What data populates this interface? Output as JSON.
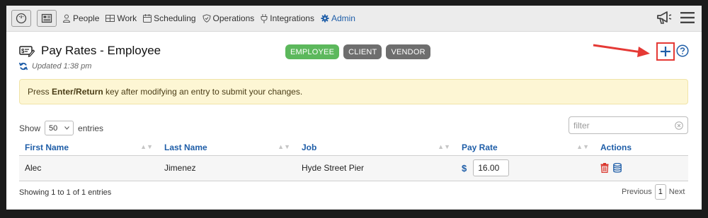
{
  "nav": {
    "items": [
      {
        "label": "People",
        "icon": "person-icon"
      },
      {
        "label": "Work",
        "icon": "work-grid-icon"
      },
      {
        "label": "Scheduling",
        "icon": "calendar-icon"
      },
      {
        "label": "Operations",
        "icon": "shield-icon"
      },
      {
        "label": "Integrations",
        "icon": "plug-icon"
      },
      {
        "label": "Admin",
        "icon": "gear-icon"
      }
    ],
    "active": "Admin"
  },
  "header": {
    "title": "Pay Rates - Employee",
    "updated": "Updated 1:38 pm",
    "tabs": [
      "EMPLOYEE",
      "CLIENT",
      "VENDOR"
    ],
    "active_tab": "EMPLOYEE"
  },
  "alert": {
    "prefix": "Press ",
    "key": "Enter/Return",
    "suffix": " key after modifying an entry to submit your changes."
  },
  "controls": {
    "show_label": "Show",
    "page_size": "50",
    "entries_label": "entries",
    "filter_placeholder": "filter"
  },
  "table": {
    "columns": [
      "First Name",
      "Last Name",
      "Job",
      "Pay Rate",
      "Actions"
    ],
    "rows": [
      {
        "first": "Alec",
        "last": "Jimenez",
        "job": "Hyde Street Pier",
        "currency": "$",
        "rate": "16.00"
      }
    ]
  },
  "footer": {
    "info": "Showing 1 to 1 of 1 entries",
    "previous": "Previous",
    "page": "1",
    "next": "Next"
  },
  "colors": {
    "accent": "#1f5ea8",
    "employee_pill": "#5cb85c",
    "other_pill": "#6e6e6e",
    "highlight": "#e53935",
    "alert_bg": "#fdf6d4"
  }
}
